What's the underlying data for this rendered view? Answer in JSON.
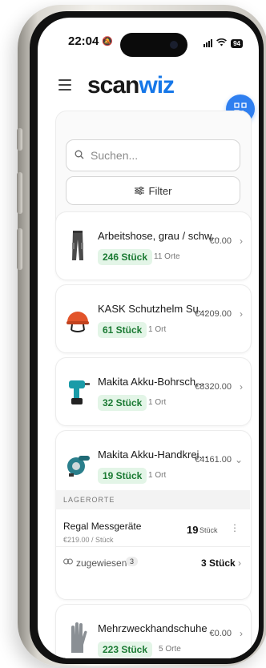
{
  "status": {
    "time": "22:04",
    "battery": "94"
  },
  "brand": {
    "part1": "scan",
    "part2": "wiz"
  },
  "search": {
    "placeholder": "Suchen..."
  },
  "filter": {
    "label": "Filter"
  },
  "products": [
    {
      "name": "Arbeitshose, grau / schw...",
      "price": "€0.00",
      "qty": "246 Stück",
      "locations": "11 Orte",
      "icon": "pants-icon"
    },
    {
      "name": "KASK Schutzhelm Su...",
      "price": "€4209.00",
      "qty": "61 Stück",
      "locations": "1 Ort",
      "icon": "helmet-icon"
    },
    {
      "name": "Makita Akku-Bohrsch...",
      "price": "€8320.00",
      "qty": "32 Stück",
      "locations": "1 Ort",
      "icon": "drill-icon"
    },
    {
      "name": "Makita Akku-Handkrei...",
      "price": "€4161.00",
      "qty": "19 Stück",
      "locations": "1 Ort",
      "icon": "saw-icon",
      "expanded": true
    },
    {
      "name": "Mehrzweckhandschuhe",
      "price": "€0.00",
      "qty": "223 Stück",
      "locations": "5 Orte",
      "icon": "glove-icon"
    }
  ],
  "storage": {
    "section_label": "LAGERORTE",
    "location_name": "Regal Messgeräte",
    "location_price": "€219.00 / Stück",
    "location_qty": "19",
    "location_unit": "Stück",
    "assigned_label": "zugewiesen",
    "assigned_count": "3",
    "assigned_total": "3 Stück"
  },
  "colors": {
    "accent": "#2f7ff0",
    "badge_bg": "#e3f5e7",
    "badge_fg": "#1b7a33"
  }
}
